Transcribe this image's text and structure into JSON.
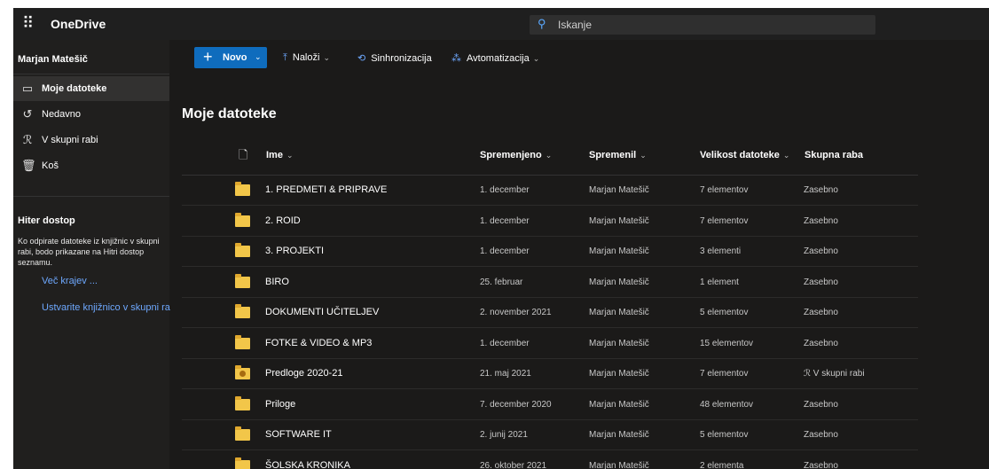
{
  "app": {
    "name": "OneDrive"
  },
  "search": {
    "placeholder": "Iskanje"
  },
  "user": {
    "name": "Marjan Matešič"
  },
  "nav": [
    {
      "label": "Moje datoteke",
      "icon": "folder-icon",
      "active": true
    },
    {
      "label": "Nedavno",
      "icon": "history-icon",
      "active": false
    },
    {
      "label": "V skupni rabi",
      "icon": "people-icon",
      "active": false
    },
    {
      "label": "Koš",
      "icon": "trash-icon",
      "active": false
    }
  ],
  "quick_access": {
    "title": "Hiter dostop",
    "description": "Ko odpirate datoteke iz knjižnic v skupni rabi, bodo prikazane na Hitri dostop seznamu.",
    "more_link": "Več krajev ...",
    "create_link": "Ustvarite knjižnico v skupni ra"
  },
  "commands": {
    "new": "Novo",
    "upload": "Naloži",
    "sync": "Sinhronizacija",
    "automate": "Avtomatizacija"
  },
  "page": {
    "title": "Moje datoteke"
  },
  "columns": {
    "name": "Ime",
    "modified": "Spremenjeno",
    "modified_by": "Spremenil",
    "size": "Velikost datoteke",
    "sharing": "Skupna raba"
  },
  "files": [
    {
      "name": "1. PREDMETI & PRIPRAVE",
      "modified": "1. december",
      "modified_by": "Marjan Matešič",
      "size": "7 elementov",
      "sharing": "Zasebno",
      "shared": false
    },
    {
      "name": "2. ROID",
      "modified": "1. december",
      "modified_by": "Marjan Matešič",
      "size": "7 elementov",
      "sharing": "Zasebno",
      "shared": false
    },
    {
      "name": "3. PROJEKTI",
      "modified": "1. december",
      "modified_by": "Marjan Matešič",
      "size": "3 elementi",
      "sharing": "Zasebno",
      "shared": false
    },
    {
      "name": "BIRO",
      "modified": "25. februar",
      "modified_by": "Marjan Matešič",
      "size": "1 element",
      "sharing": "Zasebno",
      "shared": false
    },
    {
      "name": "DOKUMENTI UČITELJEV",
      "modified": "2. november 2021",
      "modified_by": "Marjan Matešič",
      "size": "5 elementov",
      "sharing": "Zasebno",
      "shared": false
    },
    {
      "name": "FOTKE & VIDEO & MP3",
      "modified": "1. december",
      "modified_by": "Marjan Matešič",
      "size": "15 elementov",
      "sharing": "Zasebno",
      "shared": false
    },
    {
      "name": "Predloge 2020-21",
      "modified": "21. maj 2021",
      "modified_by": "Marjan Matešič",
      "size": "7 elementov",
      "sharing": "V skupni rabi",
      "shared": true
    },
    {
      "name": "Priloge",
      "modified": "7. december 2020",
      "modified_by": "Marjan Matešič",
      "size": "48 elementov",
      "sharing": "Zasebno",
      "shared": false
    },
    {
      "name": "SOFTWARE IT",
      "modified": "2. junij 2021",
      "modified_by": "Marjan Matešič",
      "size": "5 elementov",
      "sharing": "Zasebno",
      "shared": false
    },
    {
      "name": "ŠOLSKA KRONIKA",
      "modified": "26. oktober 2021",
      "modified_by": "Marjan Matešič",
      "size": "2 elementa",
      "sharing": "Zasebno",
      "shared": false
    }
  ],
  "colors": {
    "accent": "#0f6cbd",
    "link": "#6ea8fe",
    "folder": "#f2c649",
    "background": "#1b1a19"
  }
}
